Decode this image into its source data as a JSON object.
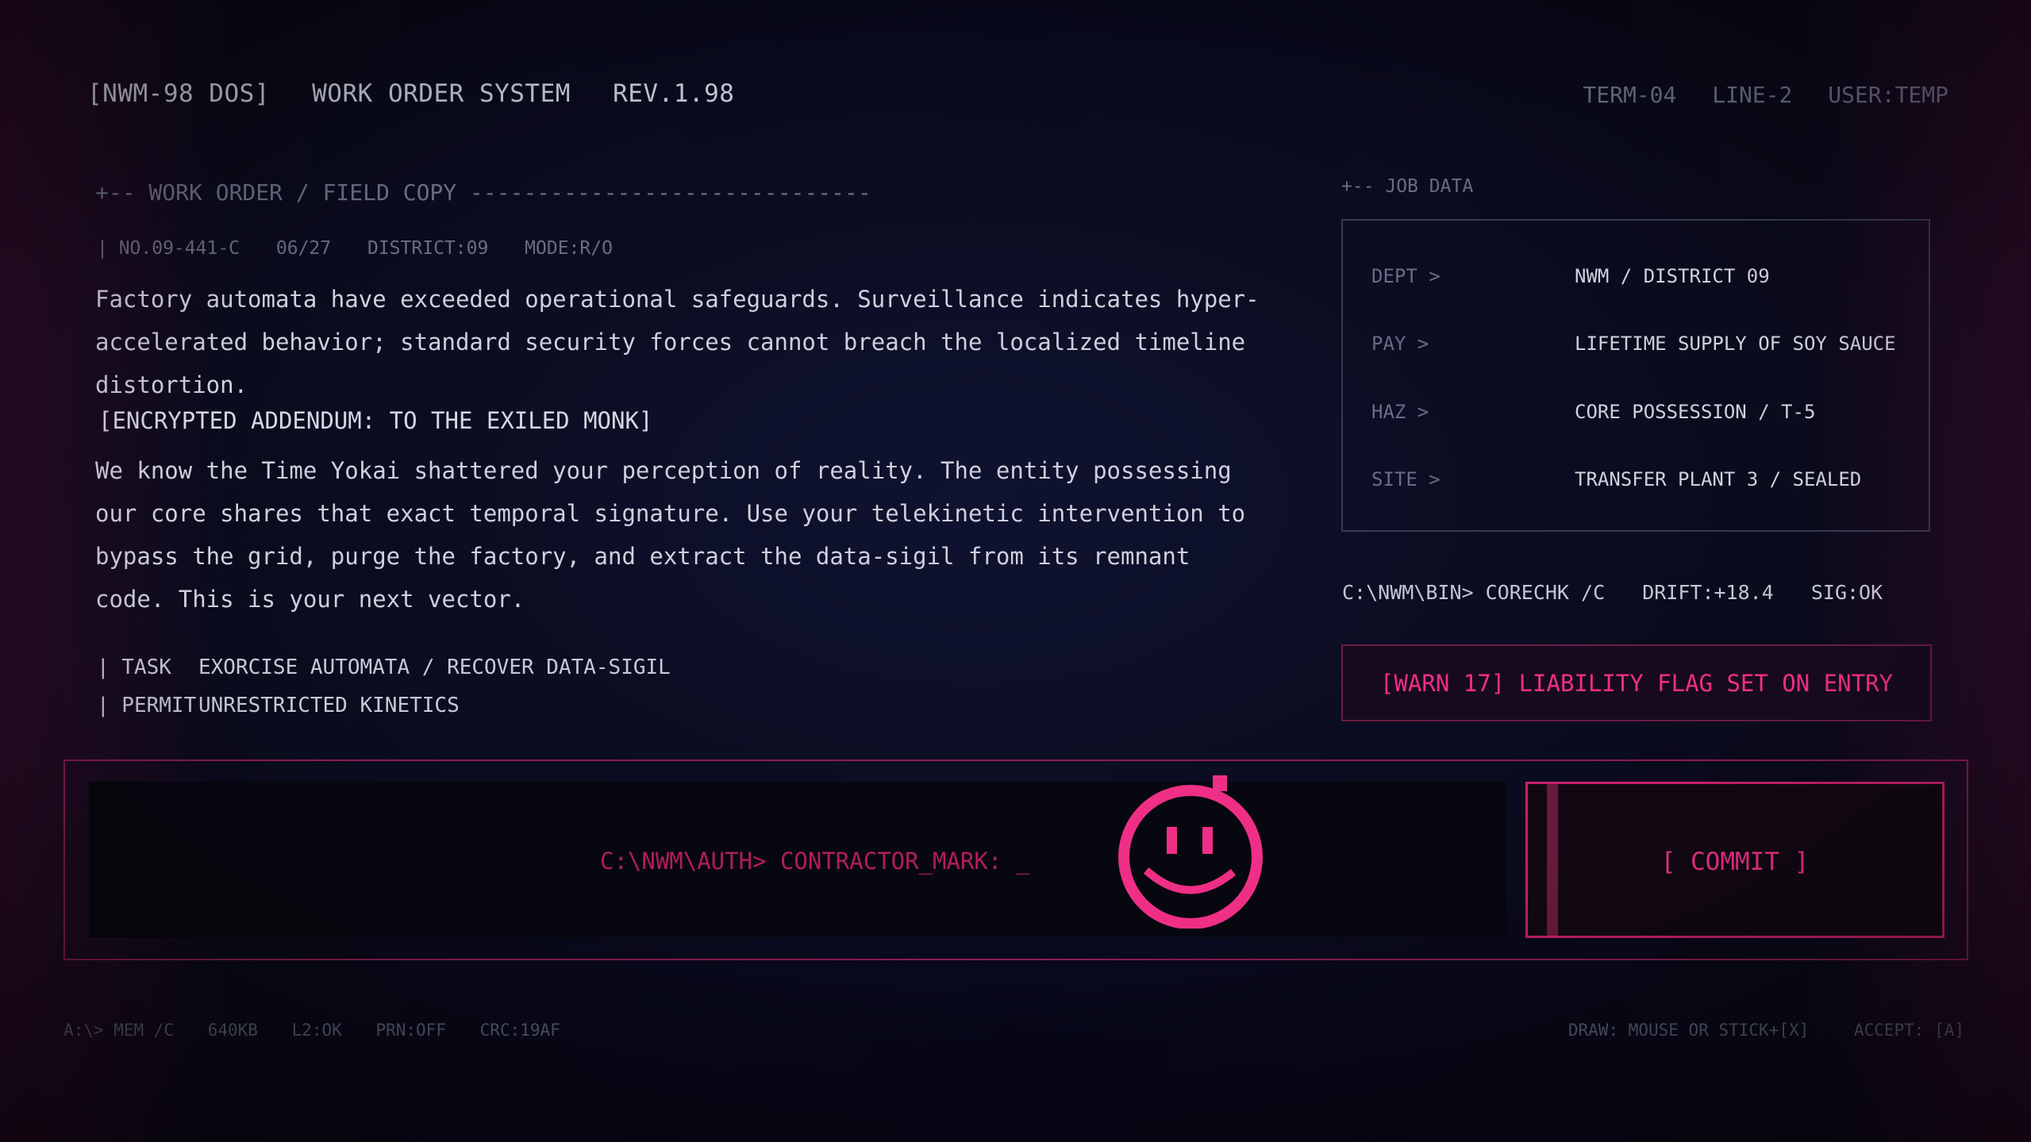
{
  "header": {
    "system": "[NWM-98 DOS]",
    "title": "WORK ORDER SYSTEM",
    "rev": "REV.1.98",
    "term": "TERM-04",
    "line": "LINE-2",
    "user": "USER:TEMP"
  },
  "order": {
    "section_title": "+-- WORK ORDER / FIELD COPY ------------------------------",
    "meta": {
      "number": "| NO.09-441-C",
      "date": "06/27",
      "district": "DISTRICT:09",
      "mode": "MODE:R/O"
    },
    "paragraph1": "Factory automata have exceeded operational safeguards. Surveillance indicates hyper-accelerated behavior; standard security forces cannot breach the localized timeline distortion.",
    "addendum_heading": "[ENCRYPTED ADDENDUM: TO THE EXILED MONK]",
    "paragraph2": "We know the Time Yokai shattered your perception of reality. The entity possessing our core shares that exact temporal signature. Use your telekinetic intervention to bypass the grid, purge the factory, and extract the data-sigil from its remnant code. This is your next vector.",
    "task_label": "| TASK",
    "task_value": "EXORCISE AUTOMATA / RECOVER DATA-SIGIL",
    "permit_label": "| PERMIT",
    "permit_value": "UNRESTRICTED KINETICS"
  },
  "job_data": {
    "title": "+-- JOB DATA",
    "rows": [
      {
        "label": "DEPT >",
        "value": "NWM / DISTRICT 09"
      },
      {
        "label": "PAY  >",
        "value": "LIFETIME SUPPLY OF SOY SAUCE"
      },
      {
        "label": "HAZ  >",
        "value": "CORE POSSESSION / T-5"
      },
      {
        "label": "SITE >",
        "value": "TRANSFER PLANT 3 / SEALED"
      }
    ],
    "command": {
      "prompt": "C:\\NWM\\BIN> CORECHK /C",
      "drift": "DRIFT:+18.4",
      "sig": "SIG:OK"
    },
    "warning": "[WARN 17] LIABILITY FLAG SET ON ENTRY"
  },
  "signature": {
    "prompt": "C:\\NWM\\AUTH> CONTRACTOR_MARK: _",
    "commit_label": "[ COMMIT ]"
  },
  "footer": {
    "mem": "A:\\> MEM /C",
    "kb": "640KB",
    "l2": "L2:OK",
    "prn": "PRN:OFF",
    "crc": "CRC:19AF",
    "draw_hint": "DRAW: MOUSE OR STICK+[X]",
    "accept_hint": "ACCEPT: [A]"
  },
  "colors": {
    "accent": "#f0308a",
    "accent_dim": "#8a1d4e",
    "text": "#cfd0dc",
    "muted": "#6a6c84"
  }
}
